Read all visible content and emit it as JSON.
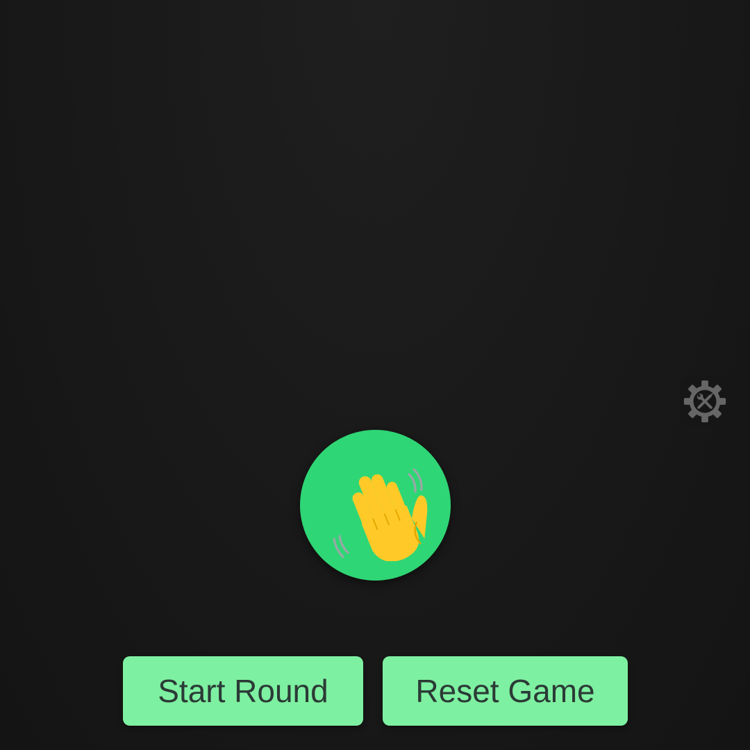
{
  "theme": {
    "wave_circle_color": "#2fd675",
    "hand_color": "#ffca28",
    "hand_outline_color": "#e6a700",
    "motion_line_color": "#9aa7a7",
    "button_color": "#7ef0a1",
    "button_text_color": "#2b3a36",
    "settings_icon_color": "#666666"
  },
  "settings": {
    "icon": "settings-tools-gear-icon"
  },
  "wave": {
    "icon": "waving-hand-icon"
  },
  "controls": {
    "start_label": "Start Round",
    "reset_label": "Reset Game"
  }
}
